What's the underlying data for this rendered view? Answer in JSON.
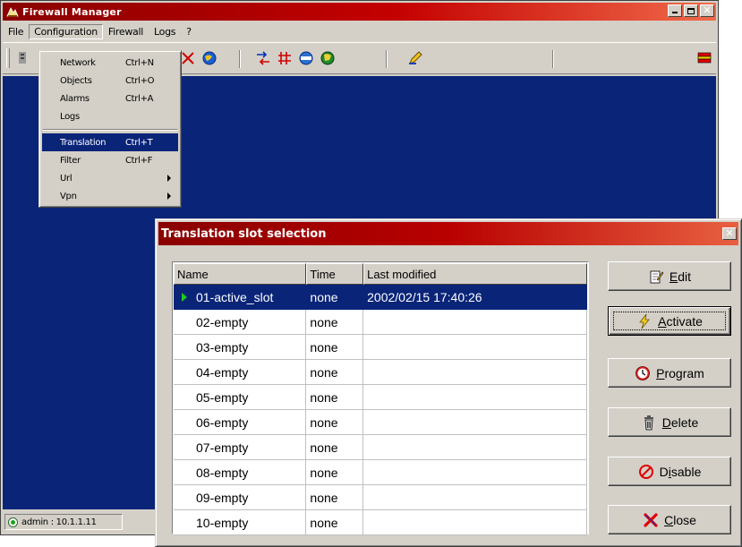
{
  "main_window": {
    "title": "Firewall Manager",
    "menu": [
      {
        "label": "File"
      },
      {
        "label": "Configuration",
        "active": true
      },
      {
        "label": "Firewall"
      },
      {
        "label": "Logs"
      },
      {
        "label": "?"
      }
    ],
    "status": "admin : 10.1.1.11"
  },
  "configuration_menu": {
    "items": [
      {
        "label": "Network",
        "shortcut": "Ctrl+N"
      },
      {
        "label": "Objects",
        "shortcut": "Ctrl+O"
      },
      {
        "label": "Alarms",
        "shortcut": "Ctrl+A"
      },
      {
        "label": "Logs",
        "shortcut": ""
      },
      {
        "label": "Translation",
        "shortcut": "Ctrl+T",
        "selected": true
      },
      {
        "label": "Filter",
        "shortcut": "Ctrl+F"
      },
      {
        "label": "Url",
        "shortcut": "",
        "submenu": true
      },
      {
        "label": "Vpn",
        "shortcut": "",
        "submenu": true
      }
    ]
  },
  "dialog": {
    "title": "Translation slot selection",
    "columns": [
      "Name",
      "Time",
      "Last modified"
    ],
    "rows": [
      {
        "name": "01-active_slot",
        "time": "none",
        "modified": "2002/02/15 17:40:26",
        "active": true
      },
      {
        "name": "02-empty",
        "time": "none",
        "modified": ""
      },
      {
        "name": "03-empty",
        "time": "none",
        "modified": ""
      },
      {
        "name": "04-empty",
        "time": "none",
        "modified": ""
      },
      {
        "name": "05-empty",
        "time": "none",
        "modified": ""
      },
      {
        "name": "06-empty",
        "time": "none",
        "modified": ""
      },
      {
        "name": "07-empty",
        "time": "none",
        "modified": ""
      },
      {
        "name": "08-empty",
        "time": "none",
        "modified": ""
      },
      {
        "name": "09-empty",
        "time": "none",
        "modified": ""
      },
      {
        "name": "10-empty",
        "time": "none",
        "modified": ""
      }
    ],
    "buttons": {
      "edit": {
        "mnemonic": "E",
        "rest": "dit",
        "icon": "edit-icon"
      },
      "activate": {
        "mnemonic": "A",
        "rest": "ctivate",
        "icon": "lightning-icon"
      },
      "program": {
        "mnemonic": "P",
        "rest": "rogram",
        "icon": "clock-icon"
      },
      "delete": {
        "mnemonic": "D",
        "rest": "elete",
        "icon": "trash-icon"
      },
      "disable": {
        "pre": "D",
        "mnemonic": "i",
        "rest": "sable",
        "icon": "prohibited-icon"
      },
      "close": {
        "mnemonic": "C",
        "rest": "lose",
        "icon": "close-x-icon"
      }
    }
  },
  "colors": {
    "title_red": "#b80000",
    "selection_blue": "#0a2478",
    "face": "#d4d0c8",
    "active_arrow": "#1ecc1e"
  }
}
